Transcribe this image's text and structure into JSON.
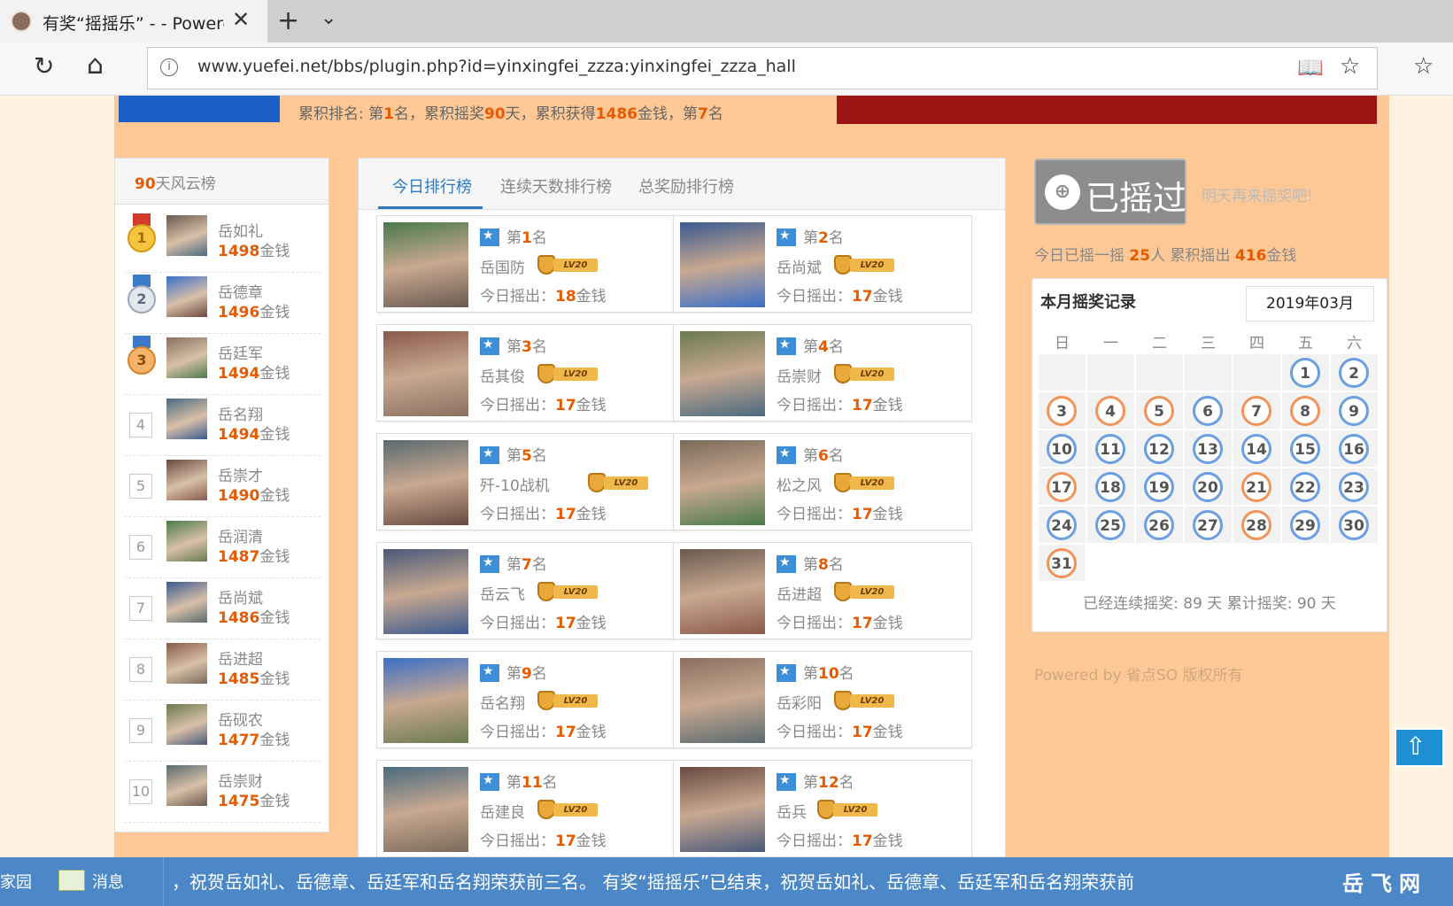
{
  "browser": {
    "tab_title": "有奖“摇摇乐” - - Powere",
    "url": "www.yuefei.net/bbs/plugin.php?id=yinxingfei_zzza:yinxingfei_zzza_hall"
  },
  "summary": {
    "prefix": "累积排名: 第",
    "rank": "1",
    "t1": "名，累积摇奖",
    "days": "90",
    "t2": "天，累积获得",
    "coins": "1486",
    "t3": "金钱，第",
    "place": "7",
    "t4": "名"
  },
  "left_list": {
    "header_num": "90",
    "header_text": "天风云榜",
    "items": [
      {
        "rank": "1",
        "name": "岳如礼",
        "coins": "1498",
        "unit": "金钱"
      },
      {
        "rank": "2",
        "name": "岳德章",
        "coins": "1496",
        "unit": "金钱"
      },
      {
        "rank": "3",
        "name": "岳廷军",
        "coins": "1494",
        "unit": "金钱"
      },
      {
        "rank": "4",
        "name": "岳名翔",
        "coins": "1494",
        "unit": "金钱"
      },
      {
        "rank": "5",
        "name": "岳崇才",
        "coins": "1490",
        "unit": "金钱"
      },
      {
        "rank": "6",
        "name": "岳润清",
        "coins": "1487",
        "unit": "金钱"
      },
      {
        "rank": "7",
        "name": "岳尚斌",
        "coins": "1486",
        "unit": "金钱"
      },
      {
        "rank": "8",
        "name": "岳进超",
        "coins": "1485",
        "unit": "金钱"
      },
      {
        "rank": "9",
        "name": "岳砚农",
        "coins": "1477",
        "unit": "金钱"
      },
      {
        "rank": "10",
        "name": "岳崇财",
        "coins": "1475",
        "unit": "金钱"
      }
    ]
  },
  "tabs": [
    "今日排行榜",
    "连续天数排行榜",
    "总奖励排行榜"
  ],
  "ranking": {
    "rank_prefix": "第",
    "rank_suffix": "名",
    "level_label": "LV20",
    "today_label": "今日摇出：",
    "unit": "金钱",
    "cards": [
      {
        "rank": "1",
        "name": "岳国防",
        "coins": "18"
      },
      {
        "rank": "2",
        "name": "岳尚斌",
        "coins": "17"
      },
      {
        "rank": "3",
        "name": "岳其俊",
        "coins": "17"
      },
      {
        "rank": "4",
        "name": "岳崇财",
        "coins": "17"
      },
      {
        "rank": "5",
        "name": "歼-10战机",
        "coins": "17"
      },
      {
        "rank": "6",
        "name": "松之风",
        "coins": "17"
      },
      {
        "rank": "7",
        "name": "岳云飞",
        "coins": "17"
      },
      {
        "rank": "8",
        "name": "岳进超",
        "coins": "17"
      },
      {
        "rank": "9",
        "name": "岳名翔",
        "coins": "17"
      },
      {
        "rank": "10",
        "name": "岳彩阳",
        "coins": "17"
      },
      {
        "rank": "11",
        "name": "岳建良",
        "coins": "17"
      },
      {
        "rank": "12",
        "name": "岳兵",
        "coins": "17"
      }
    ]
  },
  "right": {
    "shaken_label": "已摇过",
    "tomorrow": "明天再来摇奖吧!",
    "today_a": "今日已摇一摇 ",
    "today_count": "25",
    "today_b": "人 累积摇出 ",
    "today_total": "416",
    "today_c": "金钱",
    "calendar_title": "本月摇奖记录",
    "calendar_month": "2019年03月",
    "weekdays": [
      "日",
      "一",
      "二",
      "三",
      "四",
      "五",
      "六"
    ],
    "footer": "已经连续摇奖:   89 天  累计摇奖:   90 天",
    "powered": "Powered by  省点SO  版权所有",
    "colors": {
      "blue_ring": "#6b9fe0",
      "orange_ring": "#f0945a"
    }
  },
  "bottom": {
    "home": "家园",
    "messages": "消息",
    "ticker": "，祝贺岳如礼、岳德章、岳廷军和岳名翔荣获前三名。        有奖“摇摇乐”已结束，祝贺岳如礼、岳德章、岳廷军和岳名翔荣获前",
    "logo": "岳飞网"
  }
}
